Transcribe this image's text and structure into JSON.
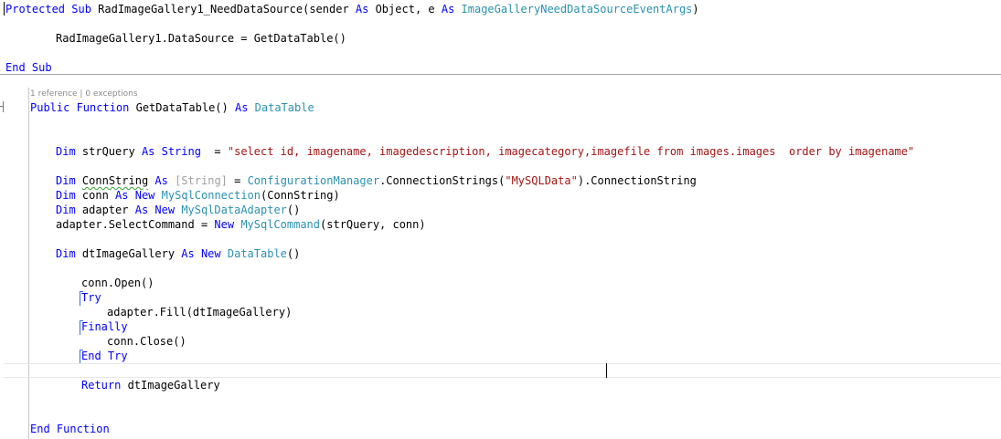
{
  "code": {
    "proc_sub": "Protected Sub",
    "proc_sub_name": " RadImageGallery1_NeedDataSource(sender ",
    "kw_as1": "As",
    "obj": " Object",
    "comma_e": ", e ",
    "kw_as2": "As",
    "evt_type": "ImageGalleryNeedDataSourceEventArgs",
    "proc_sub_close": ")",
    "datasource_line": "RadImageGallery1.DataSource = GetDataTable()",
    "end_sub": "End Sub",
    "codelens": "1 reference | 0 exceptions",
    "func_kw": "Public Function",
    "func_name": " GetDataTable() ",
    "func_as": "As",
    "func_type": "DataTable",
    "dim1": "Dim",
    "strquery_decl": " strQuery ",
    "as_string_kw": "As String",
    "eq1": "  = ",
    "query_str": "\"select id, imagename, imagedescription, imagecategory,imagefile from images.images  order by imagename\"",
    "dim2": "Dim",
    "connstring_name": "ConnString",
    "as2": "As",
    "string_bracket": "[String]",
    "eq2": " = ",
    "cfg_mgr": "ConfigurationManager",
    "conn_strings": ".ConnectionStrings(",
    "mysql_data": "\"MySQLData\"",
    "conn_string_tail": ").ConnectionString",
    "dim3": "Dim",
    "conn_name": " conn ",
    "as_new3": "As New",
    "mysql_conn": "MySqlConnection",
    "conn_args": "(ConnString)",
    "dim4": "Dim",
    "adapter_name": " adapter ",
    "as_new4": "As New",
    "mysql_adapter": "MySqlDataAdapter",
    "adapter_args": "()",
    "select_cmd": "adapter.SelectCommand = ",
    "new_kw": "New",
    "mysql_cmd": "MySqlCommand",
    "cmd_args": "(strQuery, conn)",
    "dim5": "Dim",
    "dt_name": " dtImageGallery ",
    "as_new5": "As New",
    "dt_type": "DataTable",
    "dt_args": "()",
    "conn_open": "conn.Open()",
    "try_kw": "Try",
    "fill": "adapter.Fill(dtImageGallery)",
    "finally_kw": "Finally",
    "conn_close": "conn.Close()",
    "end_try": "End Try",
    "return_kw": "Return",
    "return_val": " dtImageGallery",
    "end_function": "End Function"
  }
}
